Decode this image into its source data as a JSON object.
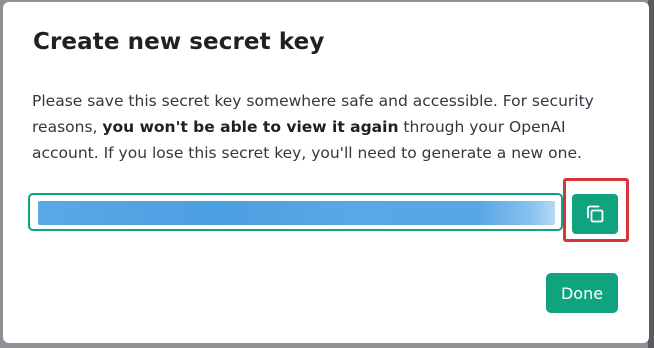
{
  "dialog": {
    "title": "Create new secret key",
    "description": {
      "part1": "Please save this secret key somewhere safe and accessible. For security reasons, ",
      "bold": "you won't be able to view it again",
      "part2": " through your OpenAI account. If you lose this secret key, you'll need to generate a new one."
    },
    "key_field": {
      "state": "redacted"
    },
    "copy_button": {
      "icon": "copy-icon"
    },
    "done_label": "Done"
  },
  "colors": {
    "accent": "#10a37f",
    "highlight": "#d9333a",
    "redaction": "#4c9fe2",
    "title_text": "#202123",
    "body_text": "#353740"
  }
}
